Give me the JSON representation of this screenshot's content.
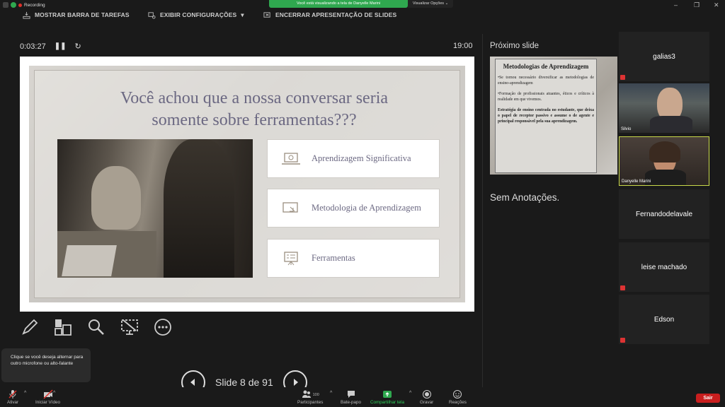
{
  "topbar": {
    "recording_label": "Recording",
    "share_banner": "Você está visualizando a tela de Danyelle Marini",
    "view_options": "Visualizar Opções"
  },
  "presenter_toolbar": {
    "show_taskbar": "MOSTRAR BARRA DE TAREFAS",
    "display_settings": "EXIBIR CONFIGURAÇÕES",
    "end_show": "ENCERRAR APRESENTAÇÃO DE SLIDES"
  },
  "timer": {
    "elapsed": "0:03:27",
    "clock": "19:00"
  },
  "slide": {
    "title_line1": "Você achou que a nossa conversar seria",
    "title_line2": "somente sobre ferramentas???",
    "cards": [
      {
        "label": "Aprendizagem Significativa",
        "icon": "laptop-icon"
      },
      {
        "label": "Metodologia de Aprendizagem",
        "icon": "screen-touch-icon"
      },
      {
        "label": "Ferramentas",
        "icon": "presentation-board-icon"
      }
    ]
  },
  "slide_nav": {
    "counter": "Slide 8 de 91"
  },
  "tooltip": {
    "text": "Clique se você deseja alternar para outro microfone ou alto-falante"
  },
  "next_slide": {
    "label": "Próximo slide",
    "title": "Metodologias de Aprendizagem",
    "bullets": [
      "•Se tornou necessário diversificar as metodologias de ensino-aprendizagem",
      "•Formação de profissionais atuantes, éticos e críticos à realidade em que vivemos.",
      "Estratégia de ensino centrada no estudante, que deixa o papel de receptor passivo e assume o de agente e principal responsável pela sua aprendizagem."
    ]
  },
  "notes": {
    "text": "Sem Anotações."
  },
  "participants": [
    {
      "name": "galias3",
      "type": "name"
    },
    {
      "name": "Silvio",
      "type": "video"
    },
    {
      "name": "Danyelle Marini",
      "type": "video"
    },
    {
      "name": "Fernandodelavale",
      "type": "name"
    },
    {
      "name": "leise machado",
      "type": "name"
    },
    {
      "name": "Edson",
      "type": "name"
    }
  ],
  "bottom_bar": {
    "mute": "Ativar",
    "video": "Iniciar Vídeo",
    "participants": "Participantes",
    "participants_count": "100",
    "chat": "Bate-papo",
    "share": "Compartilhar tela",
    "record": "Gravar",
    "reactions": "Reações",
    "leave": "Sair"
  },
  "colors": {
    "share_green": "#2fa84f",
    "leave_red": "#c81e1e",
    "slide_title": "#6b6882"
  }
}
